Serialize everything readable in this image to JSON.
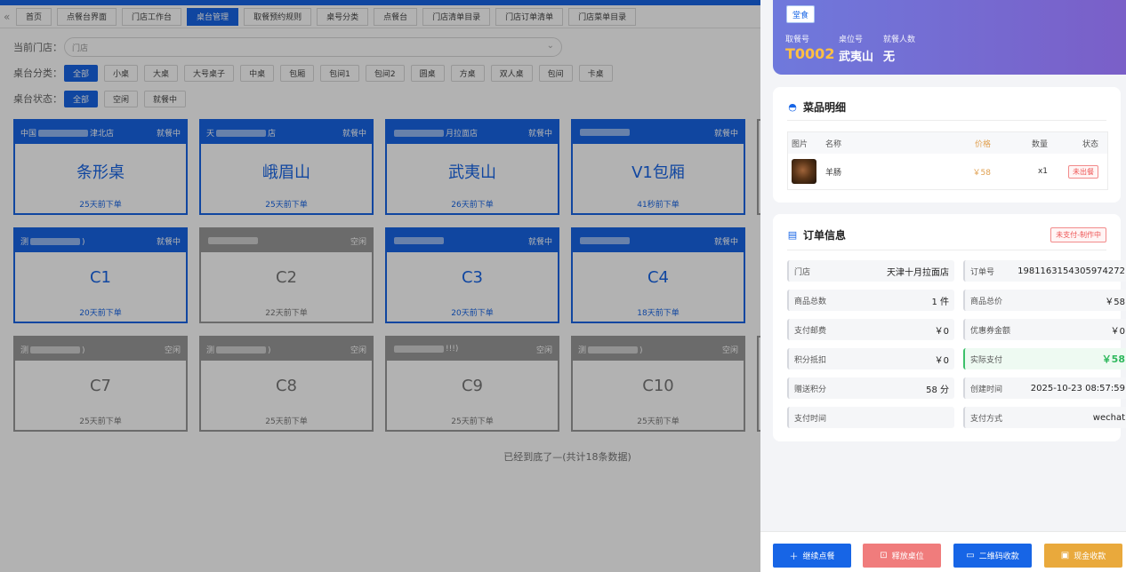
{
  "tabs": [
    {
      "label": "首页",
      "active": false
    },
    {
      "label": "点餐台界面",
      "active": false
    },
    {
      "label": "门店工作台",
      "active": false
    },
    {
      "label": "桌台管理",
      "active": true
    },
    {
      "label": "取餐预约规则",
      "active": false
    },
    {
      "label": "桌号分类",
      "active": false
    },
    {
      "label": "点餐台",
      "active": false
    },
    {
      "label": "门店清单目录",
      "active": false
    },
    {
      "label": "门店订单清单",
      "active": false
    },
    {
      "label": "门店菜单目录",
      "active": false
    }
  ],
  "filters": {
    "store_label": "当前门店：",
    "store_placeholder": "门店",
    "category_label": "桌台分类：",
    "categories": [
      "全部",
      "小桌",
      "大桌",
      "大号桌子",
      "中桌",
      "包厢",
      "包间1",
      "包间2",
      "圆桌",
      "方桌",
      "双人桌",
      "包间",
      "卡桌"
    ],
    "status_label": "桌台状态：",
    "statuses": [
      "全部",
      "空闲",
      "就餐中"
    ]
  },
  "tables": [
    {
      "store_prefix": "中国",
      "store_suffix": "津北店",
      "status": "就餐中",
      "name": "条形桌",
      "time": "25天前下单",
      "busy": true
    },
    {
      "store_prefix": "天",
      "store_suffix": "店",
      "status": "就餐中",
      "name": "峨眉山",
      "time": "25天前下单",
      "busy": true
    },
    {
      "store_prefix": "",
      "store_suffix": "月拉面店",
      "status": "就餐中",
      "name": "武夷山",
      "time": "26天前下单",
      "busy": true
    },
    {
      "store_prefix": "",
      "store_suffix": "",
      "status": "就餐中",
      "name": "V1包厢",
      "time": "41秒前下单",
      "busy": true
    },
    {
      "store_prefix": "测",
      "store_suffix": ")",
      "status": "就餐中",
      "name": "C1",
      "time": "20天前下单",
      "busy": true
    },
    {
      "store_prefix": "",
      "store_suffix": "",
      "status": "空闲",
      "name": "C2",
      "time": "22天前下单",
      "busy": false
    },
    {
      "store_prefix": "",
      "store_suffix": "",
      "status": "就餐中",
      "name": "C3",
      "time": "20天前下单",
      "busy": true
    },
    {
      "store_prefix": "",
      "store_suffix": "",
      "status": "就餐中",
      "name": "C4",
      "time": "18天前下单",
      "busy": true
    },
    {
      "store_prefix": "测",
      "store_suffix": ")",
      "status": "空闲",
      "name": "C7",
      "time": "25天前下单",
      "busy": false
    },
    {
      "store_prefix": "测",
      "store_suffix": ")",
      "status": "空闲",
      "name": "C8",
      "time": "25天前下单",
      "busy": false
    },
    {
      "store_prefix": "",
      "store_suffix": "!!!)",
      "status": "空闲",
      "name": "C9",
      "time": "25天前下单",
      "busy": false
    },
    {
      "store_prefix": "测",
      "store_suffix": ")",
      "status": "空闲",
      "name": "C10",
      "time": "25天前下单",
      "busy": false
    }
  ],
  "end_text": "已经到底了—(共计18条数据)",
  "drawer": {
    "badge": "堂食",
    "pickup_label": "取餐号",
    "pickup_value": "T0002",
    "table_label": "桌位号",
    "table_value": "武夷山",
    "diners_label": "就餐人数",
    "diners_value": "无",
    "dishes_title": "菜品明细",
    "dish_headers": {
      "img": "图片",
      "name": "名称",
      "price": "价格",
      "qty": "数量",
      "status": "状态"
    },
    "dishes": [
      {
        "name": "羊肠",
        "price": "￥58",
        "qty": "x1",
        "status": "未出餐"
      }
    ],
    "order_title": "订单信息",
    "order_status": "未支付-制作中",
    "info": [
      {
        "label": "门店",
        "value": "天津十月拉面店"
      },
      {
        "label": "订单号",
        "value": "1981163154305974272"
      },
      {
        "label": "商品总数",
        "value": "1 件"
      },
      {
        "label": "商品总价",
        "value": "￥58"
      },
      {
        "label": "支付邮费",
        "value": "￥0"
      },
      {
        "label": "优惠券金额",
        "value": "￥0"
      },
      {
        "label": "积分抵扣",
        "value": "￥0"
      },
      {
        "label": "实际支付",
        "value": "￥58"
      },
      {
        "label": "赠送积分",
        "value": "58 分"
      },
      {
        "label": "创建时间",
        "value": "2025-10-23 08:57:59"
      },
      {
        "label": "支付时间",
        "value": ""
      },
      {
        "label": "支付方式",
        "value": "wechat"
      }
    ],
    "buttons": {
      "continue": "继续点餐",
      "release": "释放桌位",
      "qrcode": "二维码收款",
      "cash": "现金收款"
    }
  },
  "colors": {
    "primary": "#1765e6",
    "idle": "#9a9a9a",
    "release": "#f07c7c",
    "cash": "#e9a93c",
    "paid_green": "#2eb85c"
  }
}
